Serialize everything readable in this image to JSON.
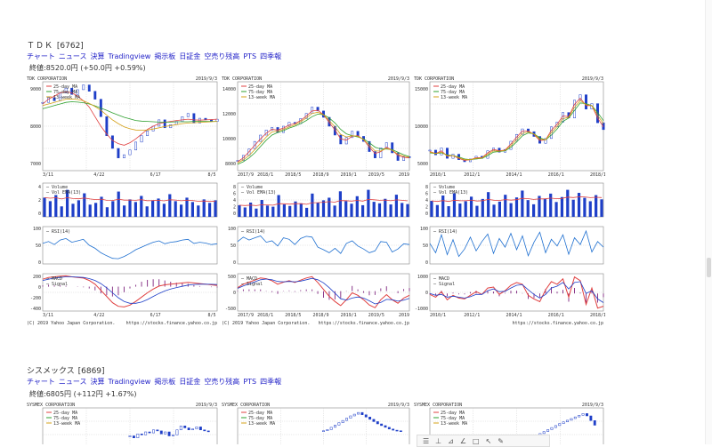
{
  "stocks": [
    {
      "name": "ＴＤＫ",
      "code": "[6762]",
      "nav": [
        "チャート",
        "ニュース",
        "決算",
        "Tradingview",
        "掲示板",
        "日証金",
        "空売り残高",
        "PTS",
        "四季報"
      ],
      "price": "終値:8520.0円 (+50.0円 +0.59%)"
    },
    {
      "name": "シスメックス",
      "code": "[6869]",
      "nav": [
        "チャート",
        "ニュース",
        "決算",
        "Tradingview",
        "掲示板",
        "日証金",
        "空売り残高",
        "PTS",
        "四季報"
      ],
      "price": "終値:6805円 (+112円 +1.67%)"
    }
  ],
  "toolbar": {
    "icons": [
      "text-tool-icon",
      "axis-tool-icon",
      "filter-icon",
      "line-icon",
      "box-icon",
      "cursor-icon",
      "pen-icon"
    ],
    "glyphs": [
      "☰",
      "⊥",
      "⊿",
      "∠",
      "□",
      "↖",
      "✎"
    ]
  },
  "colors": {
    "price": "#1e3fc8",
    "ma25": "#e04040",
    "ma75": "#2fa02f",
    "wk13": "#d4a017",
    "volume": "#1e3fc8",
    "volema": "#e04040",
    "rsi": "#1e6fd0",
    "macd": "#e04040",
    "signal": "#1e3fc8",
    "hist": "#8b3a8b",
    "grid": "#c8c8c8"
  },
  "chart_data": [
    {
      "type": "line",
      "header_left": "TDK CORPORATION",
      "header_right": "2019/9/3",
      "legend": [
        "25-day MA",
        "75-day MA",
        "13-week MA"
      ],
      "price_ticks": [
        "9000",
        "8000",
        "7000"
      ],
      "price_ylim": [
        6900,
        9700
      ],
      "x_ticks": [
        "3/11",
        "4/22",
        "6/17",
        "8/5"
      ],
      "price": [
        9050,
        9200,
        9100,
        9350,
        9500,
        9300,
        9450,
        9600,
        9400,
        9150,
        8600,
        8000,
        7600,
        7300,
        7400,
        7550,
        7800,
        8000,
        8150,
        8300,
        8500,
        8250,
        8350,
        8450,
        8600,
        8700,
        8400,
        8550,
        8500,
        8450,
        8520
      ],
      "ma25": [
        9000,
        9150,
        9250,
        9350,
        9380,
        9350,
        9250,
        9100,
        8900,
        8600,
        8300,
        8050,
        7850,
        7750,
        7700,
        7780,
        7900,
        8050,
        8200,
        8300,
        8380,
        8420,
        8450,
        8480,
        8500,
        8520,
        8500,
        8490,
        8500,
        8510,
        8520
      ],
      "ma75": [
        8850,
        8900,
        8950,
        9000,
        9050,
        9070,
        9060,
        9040,
        9000,
        8940,
        8870,
        8800,
        8720,
        8650,
        8580,
        8530,
        8480,
        8460,
        8450,
        8440,
        8430,
        8430,
        8430,
        8440,
        8440,
        8440,
        8450,
        8450,
        8450,
        8450,
        8450
      ],
      "wk13": [
        8950,
        9000,
        9050,
        9100,
        9150,
        9160,
        9140,
        9100,
        9020,
        8920,
        8800,
        8650,
        8500,
        8380,
        8280,
        8220,
        8180,
        8170,
        8180,
        8210,
        8250,
        8290,
        8320,
        8350,
        8380,
        8400,
        8410,
        8420,
        8430,
        8440,
        8450
      ],
      "volume_label": [
        "Volume",
        "Vol EMA(13)"
      ],
      "volume_ticks": [
        "4",
        "2",
        "0"
      ],
      "volume": [
        2.2,
        1.8,
        2.5,
        1.2,
        3.1,
        1.5,
        1.9,
        2.7,
        1.4,
        1.6,
        2.3,
        1.1,
        1.8,
        2.9,
        1.3,
        2.0,
        1.7,
        2.4,
        1.2,
        1.9,
        2.1,
        1.5,
        2.6,
        1.8,
        1.4,
        2.2,
        1.7,
        1.3,
        2.0,
        1.6,
        1.9
      ],
      "rsi_label": "RSI(14)",
      "rsi_ticks": [
        "100",
        "50",
        "0"
      ],
      "rsi": [
        55,
        60,
        52,
        64,
        68,
        58,
        62,
        66,
        50,
        42,
        30,
        22,
        15,
        14,
        20,
        28,
        38,
        45,
        52,
        58,
        62,
        54,
        58,
        60,
        64,
        66,
        55,
        58,
        56,
        52,
        54
      ],
      "macd_label": [
        "MACD",
        "Signal"
      ],
      "macd_ticks": [
        "200",
        "0",
        "-200",
        "-400"
      ],
      "macd": [
        120,
        150,
        160,
        170,
        175,
        160,
        150,
        140,
        100,
        40,
        -60,
        -160,
        -260,
        -320,
        -330,
        -300,
        -240,
        -170,
        -100,
        -40,
        10,
        30,
        40,
        50,
        60,
        70,
        60,
        50,
        40,
        30,
        20
      ],
      "signal": [
        100,
        120,
        140,
        150,
        160,
        160,
        155,
        150,
        130,
        100,
        50,
        -20,
        -100,
        -180,
        -240,
        -270,
        -270,
        -250,
        -210,
        -160,
        -110,
        -70,
        -40,
        -15,
        5,
        25,
        35,
        40,
        40,
        38,
        34
      ],
      "footer_left": "(C) 2019 Yahoo Japan Corporation.",
      "footer_right": "https://stocks.finance.yahoo.co.jp"
    },
    {
      "type": "line",
      "header_left": "TDK CORPORATION",
      "header_right": "2019/9/3",
      "legend": [
        "25-day MA",
        "75-day MA",
        "13-week MA"
      ],
      "price_ticks": [
        "14000",
        "12000",
        "10000",
        "8000"
      ],
      "price_ylim": [
        7500,
        14500
      ],
      "x_ticks": [
        "2017/9",
        "2018/1",
        "2018/5",
        "2018/9",
        "2019/1",
        "2019/5",
        "2019"
      ],
      "price": [
        8300,
        8700,
        9200,
        9800,
        10300,
        10700,
        10900,
        10500,
        11000,
        11300,
        11200,
        11600,
        12000,
        12500,
        12200,
        11700,
        11000,
        10300,
        9600,
        10100,
        10600,
        10200,
        9800,
        9000,
        8500,
        9300,
        9700,
        8900,
        8300,
        8600,
        8520
      ],
      "ma25": [
        8200,
        8500,
        9000,
        9500,
        10000,
        10450,
        10750,
        10700,
        10850,
        11100,
        11200,
        11450,
        11800,
        12200,
        12250,
        11900,
        11300,
        10700,
        10000,
        9900,
        10200,
        10250,
        9950,
        9350,
        8850,
        9000,
        9350,
        9100,
        8700,
        8550,
        8500
      ],
      "ma75": [
        8000,
        8200,
        8500,
        8900,
        9400,
        9900,
        10300,
        10500,
        10650,
        10850,
        11000,
        11200,
        11450,
        11750,
        11950,
        11900,
        11650,
        11250,
        10750,
        10400,
        10250,
        10150,
        10000,
        9700,
        9350,
        9200,
        9200,
        9150,
        8950,
        8750,
        8600
      ],
      "wk13": [
        8100,
        8350,
        8700,
        9150,
        9650,
        10150,
        10550,
        10600,
        10750,
        10950,
        11100,
        11350,
        11650,
        12000,
        12100,
        11900,
        11450,
        10950,
        10350,
        10150,
        10250,
        10200,
        9950,
        9500,
        9050,
        9050,
        9250,
        9100,
        8800,
        8650,
        8550
      ],
      "volume_label": [
        "Volume",
        "Vol EMA(13)"
      ],
      "volume_ticks": [
        "8",
        "6",
        "4",
        "2",
        "0"
      ],
      "volume": [
        3.1,
        2.5,
        3.8,
        2.2,
        4.5,
        3.0,
        2.7,
        5.8,
        3.3,
        2.9,
        4.1,
        3.6,
        2.4,
        6.2,
        3.8,
        4.4,
        5.1,
        3.0,
        6.8,
        4.2,
        3.5,
        5.5,
        3.1,
        7.2,
        4.0,
        3.6,
        4.8,
        3.3,
        5.9,
        3.7,
        3.4
      ],
      "rsi_label": "RSI(14)",
      "rsi_ticks": [
        "100",
        "50",
        "0"
      ],
      "rsi": [
        60,
        72,
        64,
        70,
        75,
        58,
        62,
        48,
        70,
        66,
        52,
        68,
        74,
        72,
        45,
        38,
        30,
        42,
        28,
        55,
        62,
        48,
        40,
        30,
        35,
        60,
        58,
        32,
        40,
        54,
        52
      ],
      "macd_label": [
        "MACD",
        "Signal"
      ],
      "macd_ticks": [
        "500",
        "0",
        "-500"
      ],
      "macd": [
        100,
        200,
        260,
        320,
        380,
        360,
        300,
        200,
        260,
        300,
        250,
        320,
        380,
        420,
        250,
        50,
        -150,
        -300,
        -420,
        -250,
        -50,
        -120,
        -250,
        -400,
        -480,
        -250,
        -100,
        -250,
        -350,
        -200,
        -120
      ],
      "signal": [
        80,
        150,
        210,
        270,
        330,
        350,
        330,
        280,
        270,
        280,
        270,
        290,
        330,
        370,
        330,
        240,
        100,
        -60,
        -220,
        -260,
        -200,
        -170,
        -200,
        -280,
        -370,
        -330,
        -240,
        -250,
        -290,
        -260,
        -210
      ],
      "footer_left": "(C) 2019 Yahoo Japan Corporation.",
      "footer_right": "https://stocks.finance.yahoo.co.jp"
    },
    {
      "type": "line",
      "header_left": "TDK CORPORATION",
      "header_right": "2019/9/3",
      "legend": [
        "25-day MA",
        "75-day MA",
        "13-week MA"
      ],
      "price_ticks": [
        "15000",
        "10000",
        "5000"
      ],
      "price_ylim": [
        2500,
        15500
      ],
      "x_ticks": [
        "2010/1",
        "2012/1",
        "2014/1",
        "2016/1",
        "2018/1"
      ],
      "price": [
        5500,
        4800,
        5800,
        4300,
        4900,
        4100,
        3800,
        4200,
        4600,
        4300,
        5400,
        5800,
        5200,
        5600,
        6800,
        7800,
        8600,
        8200,
        7500,
        6500,
        7200,
        8900,
        9600,
        11000,
        10200,
        12800,
        13600,
        11500,
        12300,
        9500,
        8500
      ],
      "ma25": [
        5300,
        5000,
        5400,
        4600,
        4700,
        4300,
        4000,
        4100,
        4400,
        4400,
        5100,
        5600,
        5400,
        5500,
        6400,
        7400,
        8300,
        8300,
        7800,
        6900,
        7000,
        8400,
        9300,
        10500,
        10400,
        12200,
        13100,
        12000,
        12000,
        10200,
        8900
      ],
      "ma75": [
        5100,
        5000,
        5100,
        4800,
        4700,
        4500,
        4200,
        4100,
        4200,
        4300,
        4700,
        5200,
        5300,
        5400,
        5900,
        6700,
        7600,
        8000,
        7900,
        7300,
        7000,
        7700,
        8600,
        9700,
        10200,
        11300,
        12400,
        12300,
        12000,
        11000,
        9800
      ],
      "wk13": [
        5200,
        5000,
        5200,
        4700,
        4700,
        4400,
        4100,
        4100,
        4300,
        4350,
        4900,
        5400,
        5350,
        5450,
        6150,
        7050,
        7950,
        8150,
        7850,
        7100,
        7000,
        8050,
        8950,
        10100,
        10300,
        11750,
        12750,
        12150,
        12000,
        10600,
        9350
      ],
      "volume_label": [
        "Volume",
        "Vol EMA(13)"
      ],
      "volume_ticks": [
        "8",
        "6",
        "4",
        "2",
        "0"
      ],
      "volume": [
        4.2,
        3.1,
        5.6,
        2.8,
        6.2,
        3.5,
        4.1,
        5.3,
        2.9,
        4.7,
        6.5,
        3.2,
        4.0,
        5.8,
        3.6,
        5.1,
        6.9,
        4.4,
        3.3,
        5.5,
        4.8,
        6.1,
        3.9,
        5.2,
        7.1,
        4.5,
        6.3,
        5.0,
        4.1,
        5.7,
        4.6
      ],
      "rsi_label": "RSI(14)",
      "rsi_ticks": [
        "100",
        "50",
        "0"
      ],
      "rsi": [
        55,
        30,
        78,
        25,
        65,
        20,
        40,
        72,
        35,
        60,
        80,
        28,
        68,
        45,
        82,
        38,
        75,
        22,
        58,
        85,
        30,
        66,
        48,
        78,
        26,
        70,
        52,
        88,
        32,
        60,
        45
      ],
      "macd_label": [
        "MACD",
        "Signal"
      ],
      "macd_ticks": [
        "1000",
        "0",
        "-1000"
      ],
      "macd": [
        -50,
        -200,
        100,
        -350,
        -100,
        -250,
        -300,
        -100,
        100,
        -50,
        300,
        350,
        -50,
        150,
        450,
        600,
        500,
        -100,
        -300,
        -450,
        200,
        650,
        500,
        800,
        -200,
        900,
        700,
        -600,
        300,
        -800,
        -700
      ],
      "signal": [
        0,
        -100,
        -50,
        -200,
        -150,
        -200,
        -250,
        -180,
        -50,
        -50,
        150,
        250,
        100,
        120,
        300,
        450,
        480,
        200,
        -50,
        -250,
        -50,
        300,
        400,
        600,
        250,
        600,
        650,
        0,
        150,
        -300,
        -500
      ],
      "footer_left": "",
      "footer_right": "https://stocks.finance.yahoo.co.jp"
    },
    {
      "type": "line",
      "header_left": "SYSMEX CORPORATION",
      "header_right": "2019/9/3",
      "legend": [
        "25-day MA",
        "75-day MA",
        "13-week MA"
      ],
      "price_ticks": [],
      "price_ylim": [
        6000,
        8000
      ],
      "x_ticks": [],
      "price": [
        6600,
        6500,
        6700,
        6650,
        6800,
        6750,
        6900,
        6850,
        6700,
        6800,
        6600,
        6650,
        6900,
        7100,
        7000,
        6900,
        6950,
        7050,
        6900,
        6850,
        6805
      ],
      "footer_left": "",
      "footer_right": ""
    },
    {
      "type": "line",
      "header_left": "SYSMEX CORPORATION",
      "header_right": "2019/9/3",
      "legend": [
        "25-day MA",
        "75-day MA",
        "13-week MA"
      ],
      "price_ticks": [],
      "price_ylim": [
        5000,
        12000
      ],
      "x_ticks": [],
      "price": [
        8000,
        8200,
        8600,
        9000,
        9400,
        9800,
        10200,
        10600,
        10900,
        11200,
        10800,
        10400,
        10000,
        9600,
        9200,
        8900,
        8600,
        8300,
        8100,
        8000,
        7900
      ],
      "footer_left": "",
      "footer_right": ""
    },
    {
      "type": "line",
      "header_left": "SYSMEX CORPORATION",
      "header_right": "2019/9/3",
      "legend": [
        "25-day MA",
        "75-day MA",
        "13-week MA"
      ],
      "price_ticks": [],
      "price_ylim": [
        0,
        12000
      ],
      "x_ticks": [],
      "price": [
        2000,
        2300,
        2600,
        2900,
        3300,
        3800,
        4300,
        4900,
        5500,
        6100,
        6700,
        7300,
        7800,
        8300,
        8800,
        9300,
        9800,
        10300,
        9600,
        8200,
        6805
      ],
      "footer_left": "",
      "footer_right": ""
    }
  ]
}
